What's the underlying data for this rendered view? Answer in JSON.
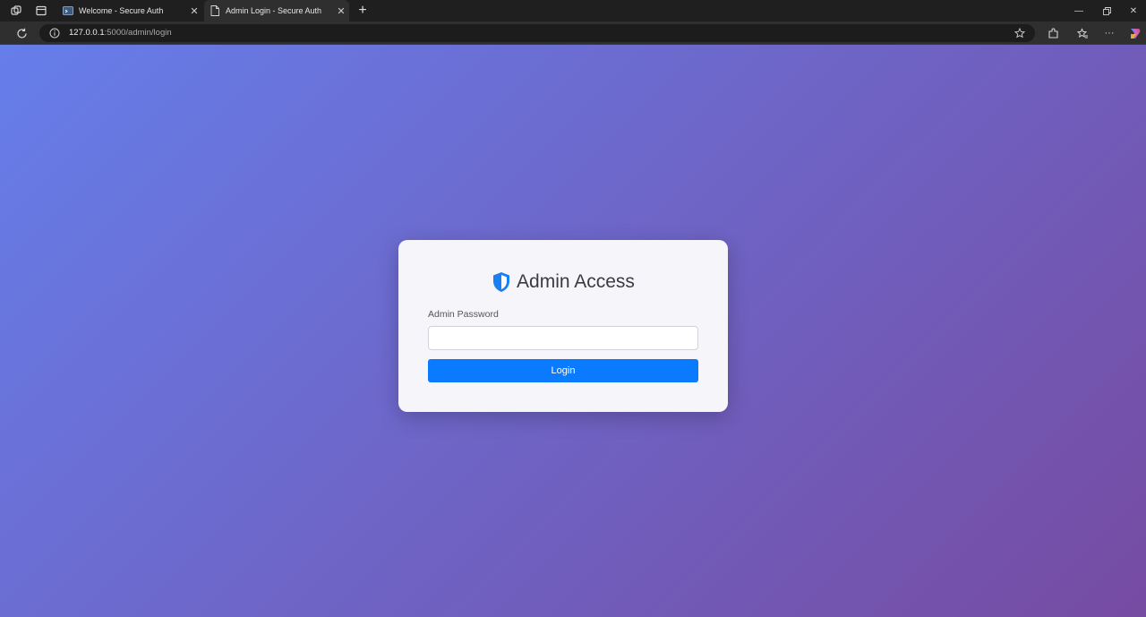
{
  "browser": {
    "tabs": [
      {
        "title": "Welcome - Secure Auth",
        "active": false
      },
      {
        "title": "Admin Login - Secure Auth",
        "active": true
      }
    ],
    "address": {
      "host": "127.0.0.1",
      "path": ":5000/admin/login"
    }
  },
  "page": {
    "heading": "Admin Access",
    "password_label": "Admin Password",
    "password_value": "",
    "login_button": "Login"
  },
  "colors": {
    "gradient_start": "#667eea",
    "gradient_end": "#764ba2",
    "button": "#0a7bff",
    "shield": "#1a7ff0"
  }
}
